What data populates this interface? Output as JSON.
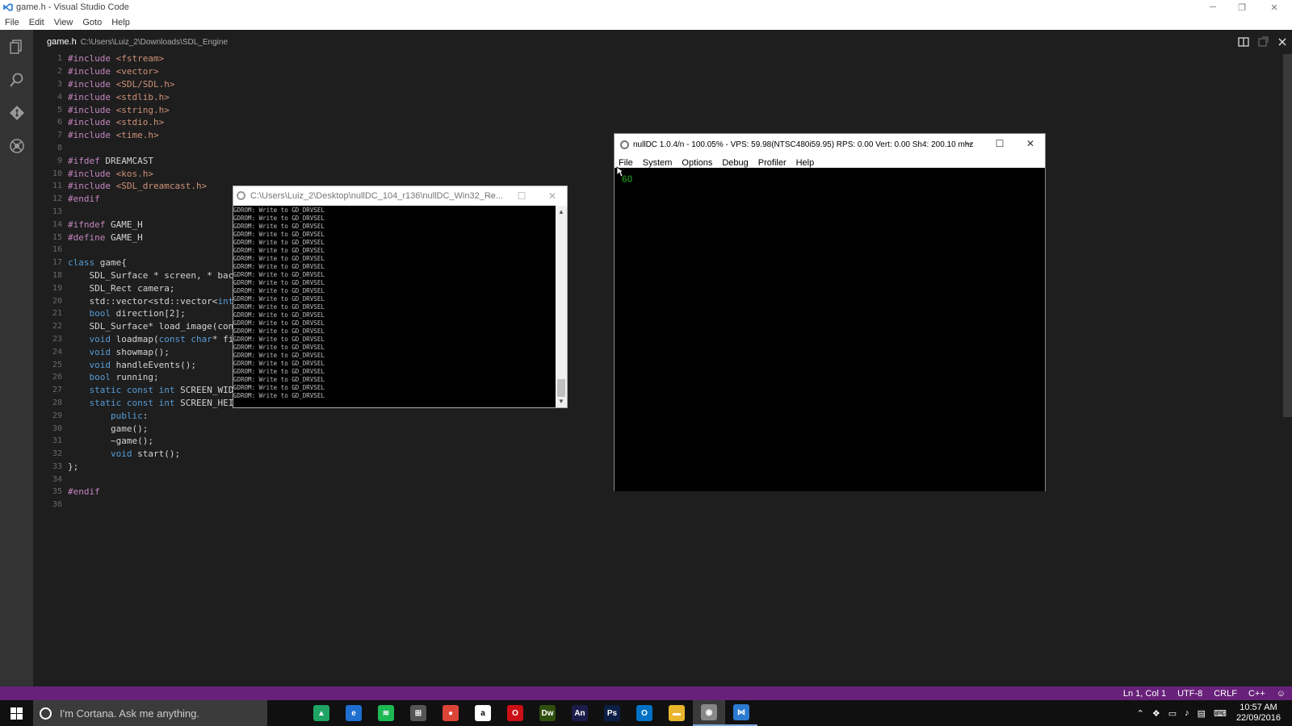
{
  "window": {
    "title": "game.h - Visual Studio Code"
  },
  "menu": [
    "File",
    "Edit",
    "View",
    "Goto",
    "Help"
  ],
  "tab": {
    "filename": "game.h",
    "path": "C:\\Users\\Luiz_2\\Downloads\\SDL_Engine"
  },
  "code": [
    {
      "n": "1",
      "t": "#include <fstream>"
    },
    {
      "n": "2",
      "t": "#include <vector>"
    },
    {
      "n": "3",
      "t": "#include <SDL/SDL.h>"
    },
    {
      "n": "4",
      "t": "#include <stdlib.h>"
    },
    {
      "n": "5",
      "t": "#include <string.h>"
    },
    {
      "n": "6",
      "t": "#include <stdio.h>"
    },
    {
      "n": "7",
      "t": "#include <time.h>"
    },
    {
      "n": "8",
      "t": ""
    },
    {
      "n": "9",
      "t": "#ifdef DREAMCAST"
    },
    {
      "n": "10",
      "t": "#include <kos.h>"
    },
    {
      "n": "11",
      "t": "#include <SDL_dreamcast.h>"
    },
    {
      "n": "12",
      "t": "#endif"
    },
    {
      "n": "13",
      "t": ""
    },
    {
      "n": "14",
      "t": "#ifndef GAME_H"
    },
    {
      "n": "15",
      "t": "#define GAME_H"
    },
    {
      "n": "16",
      "t": ""
    },
    {
      "n": "17",
      "t": "class game{"
    },
    {
      "n": "18",
      "t": "    SDL_Surface * screen, * back"
    },
    {
      "n": "19",
      "t": "    SDL_Rect camera;"
    },
    {
      "n": "20",
      "t": "    std::vector<std::vector<int>"
    },
    {
      "n": "21",
      "t": "    bool direction[2];"
    },
    {
      "n": "22",
      "t": "    SDL_Surface* load_image(cons"
    },
    {
      "n": "23",
      "t": "    void loadmap(const char* fil"
    },
    {
      "n": "24",
      "t": "    void showmap();"
    },
    {
      "n": "25",
      "t": "    void handleEvents();"
    },
    {
      "n": "26",
      "t": "    bool running;"
    },
    {
      "n": "27",
      "t": "    static const int SCREEN_WIDT"
    },
    {
      "n": "28",
      "t": "    static const int SCREEN_HEIG"
    },
    {
      "n": "29",
      "t": "        public:"
    },
    {
      "n": "30",
      "t": "        game();"
    },
    {
      "n": "31",
      "t": "        ~game();"
    },
    {
      "n": "32",
      "t": "        void start();"
    },
    {
      "n": "33",
      "t": "};"
    },
    {
      "n": "34",
      "t": ""
    },
    {
      "n": "35",
      "t": "#endif"
    },
    {
      "n": "36",
      "t": ""
    }
  ],
  "console": {
    "title": "C:\\Users\\Luiz_2\\Desktop\\nullDC_104_r136\\nullDC_Win32_Re...",
    "line": "GDROM: Write to GD_DRVSEL",
    "line_count": 24
  },
  "nulldc": {
    "title": "nullDC 1.0.4/n - 100.05% - VPS: 59.98(NTSC480i59.95) RPS: 0.00 Vert: 0.00  Sh4: 200.10 mhz",
    "menu": [
      "File",
      "System",
      "Options",
      "Debug",
      "Profiler",
      "Help"
    ],
    "fps": "60"
  },
  "status": {
    "position": "Ln 1, Col 1",
    "encoding": "UTF-8",
    "eol": "CRLF",
    "language": "C++"
  },
  "taskbar": {
    "search_placeholder": "I'm Cortana. Ask me anything.",
    "time": "10:57 AM",
    "date": "22/09/2016",
    "apps": [
      {
        "name": "task-view-icon",
        "label": "",
        "color": "#101010"
      },
      {
        "name": "google-drive-icon",
        "label": "▲",
        "color": "#1fa463"
      },
      {
        "name": "edge-icon",
        "label": "e",
        "color": "#1e6fd0"
      },
      {
        "name": "spotify-icon",
        "label": "≋",
        "color": "#1db954"
      },
      {
        "name": "store-icon",
        "label": "⊞",
        "color": "#555555"
      },
      {
        "name": "chrome-icon",
        "label": "●",
        "color": "#db4437"
      },
      {
        "name": "amazon-icon",
        "label": "a",
        "color": "#ffffff"
      },
      {
        "name": "opera-icon",
        "label": "O",
        "color": "#cc0f16"
      },
      {
        "name": "dreamweaver-icon",
        "label": "Dw",
        "color": "#2f4f0f"
      },
      {
        "name": "animate-icon",
        "label": "An",
        "color": "#1c1c4a"
      },
      {
        "name": "photoshop-icon",
        "label": "Ps",
        "color": "#0b1f45"
      },
      {
        "name": "outlook-icon",
        "label": "O",
        "color": "#0072c6"
      },
      {
        "name": "file-explorer-icon",
        "label": "▬",
        "color": "#e8b52c"
      },
      {
        "name": "nulldc-icon",
        "label": "◉",
        "color": "#888888"
      },
      {
        "name": "vscode-icon",
        "label": "⋈",
        "color": "#2b7bd0"
      }
    ]
  }
}
